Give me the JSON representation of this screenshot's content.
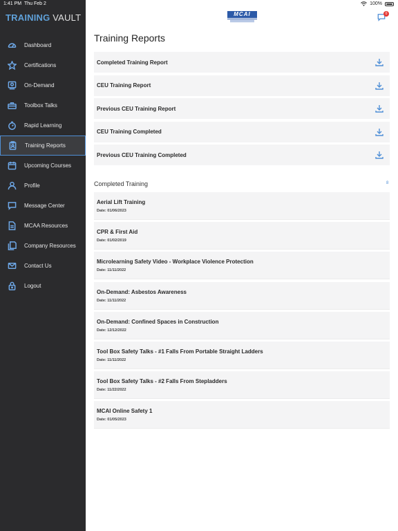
{
  "status": {
    "time": "1:41 PM",
    "date": "Thu Feb 2",
    "battery": "100%"
  },
  "brand": {
    "part1": "TRAINING",
    "part2": " VAULT"
  },
  "logo": {
    "text": "MCAI"
  },
  "chat": {
    "badge": "0"
  },
  "sidebar": {
    "items": [
      {
        "label": "Dashboard",
        "icon": "dashboard-icon"
      },
      {
        "label": "Certifications",
        "icon": "star-icon"
      },
      {
        "label": "On-Demand",
        "icon": "video-icon"
      },
      {
        "label": "Toolbox Talks",
        "icon": "toolbox-icon"
      },
      {
        "label": "Rapid Learning",
        "icon": "stopwatch-icon"
      },
      {
        "label": "Training Reports",
        "icon": "clipboard-icon"
      },
      {
        "label": "Upcoming Courses",
        "icon": "calendar-icon"
      },
      {
        "label": "Profile",
        "icon": "user-icon"
      },
      {
        "label": "Message Center",
        "icon": "message-icon"
      },
      {
        "label": "MCAA Resources",
        "icon": "document-icon"
      },
      {
        "label": "Company Resources",
        "icon": "documents-icon"
      },
      {
        "label": "Contact Us",
        "icon": "envelope-icon"
      },
      {
        "label": "Logout",
        "icon": "lock-icon"
      }
    ],
    "active_index": 5
  },
  "main": {
    "title": "Training Reports",
    "reports": [
      {
        "label": "Completed Training Report"
      },
      {
        "label": "CEU Training Report"
      },
      {
        "label": "Previous CEU Training Report"
      },
      {
        "label": "CEU Training Completed"
      },
      {
        "label": "Previous CEU Training Completed"
      }
    ],
    "completed": {
      "title": "Completed Training",
      "count": "8",
      "items": [
        {
          "name": "Aerial Lift Training",
          "date": "Date: 01/06/2023"
        },
        {
          "name": "CPR & First Aid",
          "date": "Date: 01/02/2019"
        },
        {
          "name": "Microlearning Safety Video - Workplace Violence Protection",
          "date": "Date: 11/11/2022"
        },
        {
          "name": "On-Demand: Asbestos Awareness",
          "date": "Date: 11/11/2022"
        },
        {
          "name": "On-Demand: Confined Spaces in Construction",
          "date": "Date: 12/12/2022"
        },
        {
          "name": "Tool Box Safety Talks - #1 Falls From Portable Straight Ladders",
          "date": "Date: 11/11/2022"
        },
        {
          "name": "Tool Box Safety Talks - #2 Falls From Stepladders",
          "date": "Date: 11/22/2022"
        },
        {
          "name": "MCAI Online Safety 1",
          "date": "Date: 01/05/2023"
        }
      ]
    }
  },
  "colors": {
    "sidebar_bg": "#2b2b2d",
    "accent": "#4f8fd6",
    "row_bg": "#f4f4f5",
    "badge": "#e53935"
  }
}
